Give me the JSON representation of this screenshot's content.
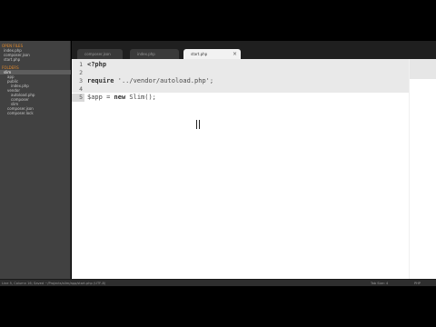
{
  "sidebar": {
    "items": [
      {
        "label": "OPEN FILES"
      },
      {
        "label": "index.php"
      },
      {
        "label": "composer.json"
      },
      {
        "label": "start.php"
      },
      {
        "label": "FOLDERS"
      },
      {
        "label": "slim"
      },
      {
        "label": "app"
      },
      {
        "label": "public"
      },
      {
        "label": "index.php"
      },
      {
        "label": "vendor"
      },
      {
        "label": "autoload.php"
      },
      {
        "label": "composer"
      },
      {
        "label": "slim"
      },
      {
        "label": "composer.json"
      },
      {
        "label": "composer.lock"
      }
    ]
  },
  "tabs": [
    {
      "label": "composer.json",
      "active": false
    },
    {
      "label": "index.php",
      "active": false
    },
    {
      "label": "start.php",
      "active": true,
      "close": "×"
    }
  ],
  "editor": {
    "lines": [
      {
        "number": "1",
        "segments": [
          {
            "cls": "kw",
            "text": "<?php"
          }
        ]
      },
      {
        "number": "2",
        "segments": []
      },
      {
        "number": "3",
        "segments": [
          {
            "cls": "kw",
            "text": "require"
          },
          {
            "cls": "str",
            "text": " '../vendor/autoload.php';"
          }
        ]
      },
      {
        "number": "4",
        "segments": []
      },
      {
        "number": "5",
        "segments": [
          {
            "cls": "var",
            "text": "$app = "
          },
          {
            "cls": "kw",
            "text": "new"
          },
          {
            "cls": "var",
            "text": " Slim();"
          }
        ]
      }
    ]
  },
  "statusbar": {
    "left": "Line 5, Column 16; Saved ~/Projects/slim/app/start.php (UTF-8)",
    "right": "Tab Size: 4",
    "syntax": "PHP"
  }
}
